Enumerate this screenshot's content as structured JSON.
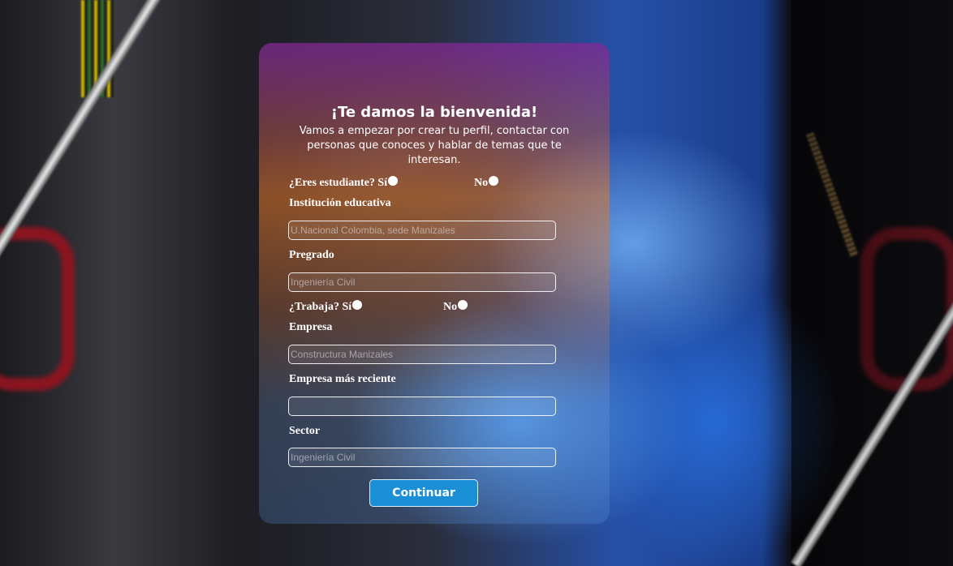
{
  "form": {
    "title": "¡Te damos la bienvenida!",
    "subtitle": "Vamos a empezar por crear tu perfil, contactar con personas que conoces y hablar de temas que te interesan.",
    "student_question": "¿Eres estudiante? Sí",
    "student_no": "No",
    "institution_label": "Institución educativa",
    "institution_placeholder": "U.Nacional Colombia, sede Manizales",
    "degree_label": "Pregrado",
    "degree_placeholder": "Ingeniería Civil",
    "work_question": "¿Trabaja? Sí",
    "work_no": "No",
    "company_label": "Empresa",
    "company_placeholder": "Constructura Manizales",
    "recent_company_label": "Empresa más reciente",
    "recent_company_placeholder": "",
    "sector_label": "Sector",
    "sector_placeholder": "Ingeniería Civil",
    "continue_label": "Continuar"
  },
  "colors": {
    "button": "#1a8fd6",
    "text": "#ffffff"
  }
}
